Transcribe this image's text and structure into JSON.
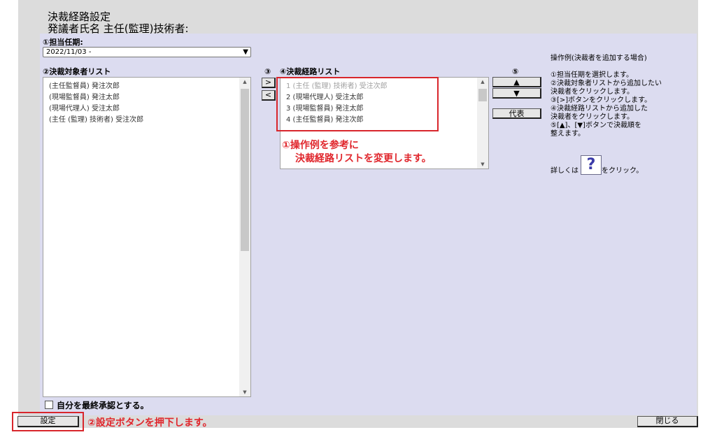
{
  "header": {
    "title": "決裁経路設定",
    "subtitle": "発議者氏名  主任(監理)技術者:"
  },
  "period": {
    "label": "①担当任期:",
    "selected": "2022/11/03 -"
  },
  "left_list": {
    "label": "②決裁対象者リスト",
    "items": [
      "(主任監督員) 発注次郎",
      "(現場監督員) 発注太郎",
      "(現場代理人) 受注太郎",
      "(主任 (監理) 技術者) 受注次郎"
    ]
  },
  "transfer": {
    "label": "③",
    "add": ">",
    "remove": "<"
  },
  "route_list": {
    "label": "④決裁経路リスト",
    "items": [
      "1 (主任 (監理) 技術者) 受注次郎",
      "2 (現場代理人) 受注太郎",
      "3 (現場監督員) 発注太郎",
      "4 (主任監督員) 発注次郎"
    ]
  },
  "order": {
    "label": "⑤",
    "up": "▲",
    "down": "▼",
    "delegate": "代表"
  },
  "help": {
    "title": "操作例(決裁者を追加する場合)",
    "steps": "①担当任期を選択します。\n②決裁対象者リストから追加したい\n決裁者をクリックします。\n③[>]ボタンをクリックします。\n④決裁経路リストから追加した\n決裁者をクリックします。\n⑤[▲]、[▼]ボタンで決裁順を\n整えます。",
    "detail_prefix": "詳しくは",
    "detail_icon": "?",
    "detail_suffix": "をクリック。"
  },
  "annotations": {
    "note1_line1": "①操作例を参考に",
    "note1_line2": "決裁経路リストを変更します。",
    "note2": "②設定ボタンを押下します。",
    "color": "#e0262c"
  },
  "final_approval": {
    "label": "自分を最終承認とする。",
    "checked": false
  },
  "footer": {
    "set": "設定",
    "close": "閉じる"
  }
}
